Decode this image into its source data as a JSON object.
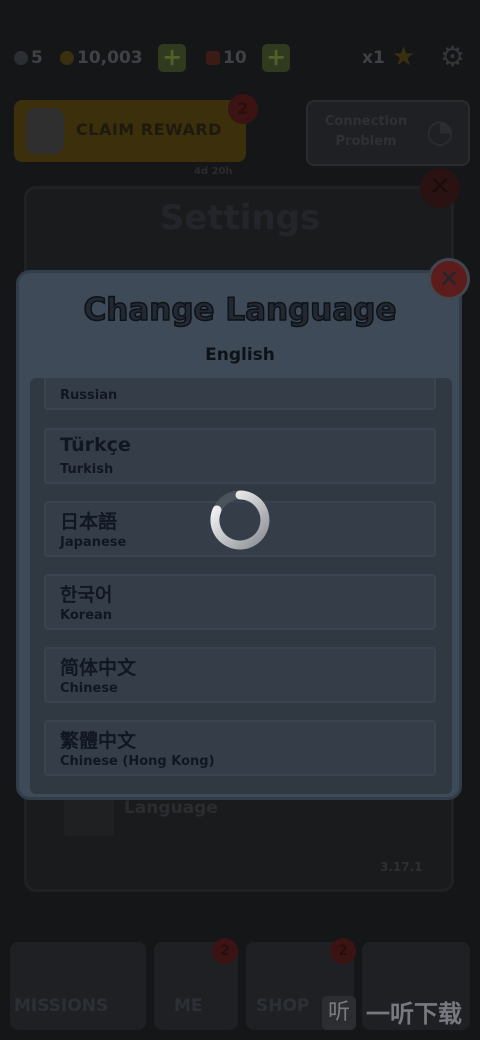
{
  "hud": {
    "keys": "5",
    "coins": "10,003",
    "hoverboards": "10",
    "multiplier": "x1"
  },
  "claim": {
    "label": "CLAIM REWARD",
    "badge": "2",
    "timer": "4d 20h"
  },
  "connection": {
    "label": "Connection Problem"
  },
  "settings": {
    "title": "Settings",
    "language_label": "Language",
    "version": "3.17.1"
  },
  "dialog": {
    "title": "Change Language",
    "current": "English",
    "languages": [
      {
        "native": "",
        "english": "Russian"
      },
      {
        "native": "Türkçe",
        "english": "Turkish"
      },
      {
        "native": "日本語",
        "english": "Japanese"
      },
      {
        "native": "한국어",
        "english": "Korean"
      },
      {
        "native": "简体中文",
        "english": "Chinese"
      },
      {
        "native": "繁體中文",
        "english": "Chinese (Hong Kong)"
      }
    ]
  },
  "tabs": [
    {
      "label": "MISSIONS",
      "badge": ""
    },
    {
      "label": "ME",
      "badge": "2"
    },
    {
      "label": "SHOP",
      "badge": "2"
    },
    {
      "label": "",
      "badge": ""
    }
  ],
  "watermark": {
    "text": "一听下载",
    "icon": "听"
  },
  "colors": {
    "dialog_bg": "#3e4a57",
    "list_bg": "#303942",
    "close_red": "#5c1c1c",
    "dim_overlay": "#151618"
  }
}
